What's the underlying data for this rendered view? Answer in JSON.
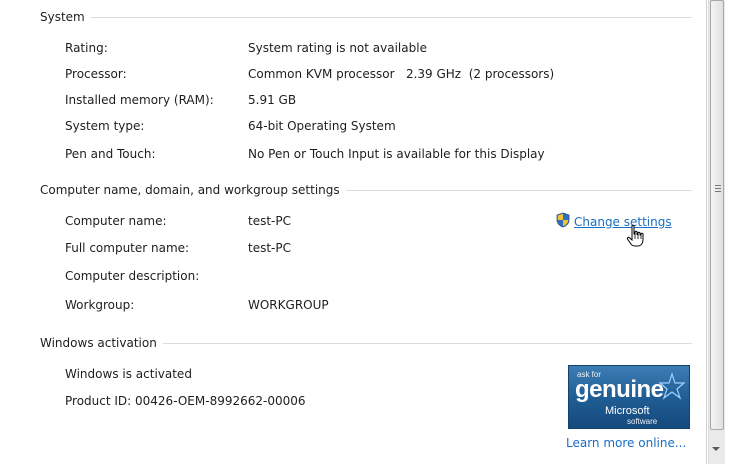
{
  "system": {
    "header": "System",
    "rows": [
      {
        "key": "Rating:",
        "value": "System rating is not available"
      },
      {
        "key": "Processor:",
        "value": "Common KVM processor   2.39 GHz  (2 processors)"
      },
      {
        "key": "Installed memory (RAM):",
        "value": "5.91 GB"
      },
      {
        "key": "System type:",
        "value": "64-bit Operating System"
      },
      {
        "key": "Pen and Touch:",
        "value": "No Pen or Touch Input is available for this Display"
      }
    ]
  },
  "computer_name": {
    "header": "Computer name, domain, and workgroup settings",
    "change_settings_label": "Change settings",
    "shield_icon": "uac-shield-icon",
    "rows": [
      {
        "key": "Computer name:",
        "value": "test-PC"
      },
      {
        "key": "Full computer name:",
        "value": "test-PC"
      },
      {
        "key": "Computer description:",
        "value": ""
      },
      {
        "key": "Workgroup:",
        "value": "WORKGROUP"
      }
    ]
  },
  "activation": {
    "header": "Windows activation",
    "status": "Windows is activated",
    "product_id": "Product ID: 00426-OEM-8992662-00006",
    "genuine_badge": {
      "ask_for": "ask for",
      "genuine": "genuine",
      "microsoft": "Microsoft",
      "software": "software"
    },
    "learn_more": "Learn more online..."
  },
  "colors": {
    "link": "#1a6ec3",
    "rule": "#d7dde3",
    "badge": "#1f5b93"
  }
}
